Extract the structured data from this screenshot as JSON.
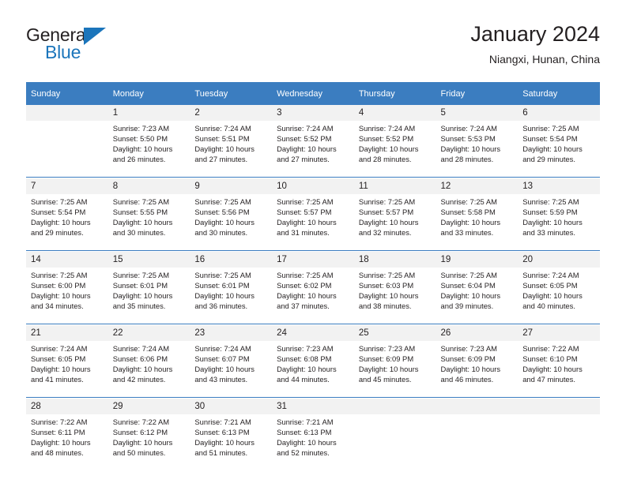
{
  "brand": {
    "name_top": "General",
    "name_bottom": "Blue",
    "accent_color": "#1b75bb"
  },
  "header": {
    "title": "January 2024",
    "subtitle": "Niangxi, Hunan, China"
  },
  "colors": {
    "header_row_bg": "#3b7dc0",
    "daynum_row_bg": "#f2f2f2",
    "separator": "#3b7dc0",
    "text": "#231f20"
  },
  "weekdays": [
    "Sunday",
    "Monday",
    "Tuesday",
    "Wednesday",
    "Thursday",
    "Friday",
    "Saturday"
  ],
  "weeks": [
    {
      "days": [
        {
          "num": "",
          "sunrise": "",
          "sunset": "",
          "daylight_1": "",
          "daylight_2": ""
        },
        {
          "num": "1",
          "sunrise": "Sunrise: 7:23 AM",
          "sunset": "Sunset: 5:50 PM",
          "daylight_1": "Daylight: 10 hours",
          "daylight_2": "and 26 minutes."
        },
        {
          "num": "2",
          "sunrise": "Sunrise: 7:24 AM",
          "sunset": "Sunset: 5:51 PM",
          "daylight_1": "Daylight: 10 hours",
          "daylight_2": "and 27 minutes."
        },
        {
          "num": "3",
          "sunrise": "Sunrise: 7:24 AM",
          "sunset": "Sunset: 5:52 PM",
          "daylight_1": "Daylight: 10 hours",
          "daylight_2": "and 27 minutes."
        },
        {
          "num": "4",
          "sunrise": "Sunrise: 7:24 AM",
          "sunset": "Sunset: 5:52 PM",
          "daylight_1": "Daylight: 10 hours",
          "daylight_2": "and 28 minutes."
        },
        {
          "num": "5",
          "sunrise": "Sunrise: 7:24 AM",
          "sunset": "Sunset: 5:53 PM",
          "daylight_1": "Daylight: 10 hours",
          "daylight_2": "and 28 minutes."
        },
        {
          "num": "6",
          "sunrise": "Sunrise: 7:25 AM",
          "sunset": "Sunset: 5:54 PM",
          "daylight_1": "Daylight: 10 hours",
          "daylight_2": "and 29 minutes."
        }
      ]
    },
    {
      "days": [
        {
          "num": "7",
          "sunrise": "Sunrise: 7:25 AM",
          "sunset": "Sunset: 5:54 PM",
          "daylight_1": "Daylight: 10 hours",
          "daylight_2": "and 29 minutes."
        },
        {
          "num": "8",
          "sunrise": "Sunrise: 7:25 AM",
          "sunset": "Sunset: 5:55 PM",
          "daylight_1": "Daylight: 10 hours",
          "daylight_2": "and 30 minutes."
        },
        {
          "num": "9",
          "sunrise": "Sunrise: 7:25 AM",
          "sunset": "Sunset: 5:56 PM",
          "daylight_1": "Daylight: 10 hours",
          "daylight_2": "and 30 minutes."
        },
        {
          "num": "10",
          "sunrise": "Sunrise: 7:25 AM",
          "sunset": "Sunset: 5:57 PM",
          "daylight_1": "Daylight: 10 hours",
          "daylight_2": "and 31 minutes."
        },
        {
          "num": "11",
          "sunrise": "Sunrise: 7:25 AM",
          "sunset": "Sunset: 5:57 PM",
          "daylight_1": "Daylight: 10 hours",
          "daylight_2": "and 32 minutes."
        },
        {
          "num": "12",
          "sunrise": "Sunrise: 7:25 AM",
          "sunset": "Sunset: 5:58 PM",
          "daylight_1": "Daylight: 10 hours",
          "daylight_2": "and 33 minutes."
        },
        {
          "num": "13",
          "sunrise": "Sunrise: 7:25 AM",
          "sunset": "Sunset: 5:59 PM",
          "daylight_1": "Daylight: 10 hours",
          "daylight_2": "and 33 minutes."
        }
      ]
    },
    {
      "days": [
        {
          "num": "14",
          "sunrise": "Sunrise: 7:25 AM",
          "sunset": "Sunset: 6:00 PM",
          "daylight_1": "Daylight: 10 hours",
          "daylight_2": "and 34 minutes."
        },
        {
          "num": "15",
          "sunrise": "Sunrise: 7:25 AM",
          "sunset": "Sunset: 6:01 PM",
          "daylight_1": "Daylight: 10 hours",
          "daylight_2": "and 35 minutes."
        },
        {
          "num": "16",
          "sunrise": "Sunrise: 7:25 AM",
          "sunset": "Sunset: 6:01 PM",
          "daylight_1": "Daylight: 10 hours",
          "daylight_2": "and 36 minutes."
        },
        {
          "num": "17",
          "sunrise": "Sunrise: 7:25 AM",
          "sunset": "Sunset: 6:02 PM",
          "daylight_1": "Daylight: 10 hours",
          "daylight_2": "and 37 minutes."
        },
        {
          "num": "18",
          "sunrise": "Sunrise: 7:25 AM",
          "sunset": "Sunset: 6:03 PM",
          "daylight_1": "Daylight: 10 hours",
          "daylight_2": "and 38 minutes."
        },
        {
          "num": "19",
          "sunrise": "Sunrise: 7:25 AM",
          "sunset": "Sunset: 6:04 PM",
          "daylight_1": "Daylight: 10 hours",
          "daylight_2": "and 39 minutes."
        },
        {
          "num": "20",
          "sunrise": "Sunrise: 7:24 AM",
          "sunset": "Sunset: 6:05 PM",
          "daylight_1": "Daylight: 10 hours",
          "daylight_2": "and 40 minutes."
        }
      ]
    },
    {
      "days": [
        {
          "num": "21",
          "sunrise": "Sunrise: 7:24 AM",
          "sunset": "Sunset: 6:05 PM",
          "daylight_1": "Daylight: 10 hours",
          "daylight_2": "and 41 minutes."
        },
        {
          "num": "22",
          "sunrise": "Sunrise: 7:24 AM",
          "sunset": "Sunset: 6:06 PM",
          "daylight_1": "Daylight: 10 hours",
          "daylight_2": "and 42 minutes."
        },
        {
          "num": "23",
          "sunrise": "Sunrise: 7:24 AM",
          "sunset": "Sunset: 6:07 PM",
          "daylight_1": "Daylight: 10 hours",
          "daylight_2": "and 43 minutes."
        },
        {
          "num": "24",
          "sunrise": "Sunrise: 7:23 AM",
          "sunset": "Sunset: 6:08 PM",
          "daylight_1": "Daylight: 10 hours",
          "daylight_2": "and 44 minutes."
        },
        {
          "num": "25",
          "sunrise": "Sunrise: 7:23 AM",
          "sunset": "Sunset: 6:09 PM",
          "daylight_1": "Daylight: 10 hours",
          "daylight_2": "and 45 minutes."
        },
        {
          "num": "26",
          "sunrise": "Sunrise: 7:23 AM",
          "sunset": "Sunset: 6:09 PM",
          "daylight_1": "Daylight: 10 hours",
          "daylight_2": "and 46 minutes."
        },
        {
          "num": "27",
          "sunrise": "Sunrise: 7:22 AM",
          "sunset": "Sunset: 6:10 PM",
          "daylight_1": "Daylight: 10 hours",
          "daylight_2": "and 47 minutes."
        }
      ]
    },
    {
      "days": [
        {
          "num": "28",
          "sunrise": "Sunrise: 7:22 AM",
          "sunset": "Sunset: 6:11 PM",
          "daylight_1": "Daylight: 10 hours",
          "daylight_2": "and 48 minutes."
        },
        {
          "num": "29",
          "sunrise": "Sunrise: 7:22 AM",
          "sunset": "Sunset: 6:12 PM",
          "daylight_1": "Daylight: 10 hours",
          "daylight_2": "and 50 minutes."
        },
        {
          "num": "30",
          "sunrise": "Sunrise: 7:21 AM",
          "sunset": "Sunset: 6:13 PM",
          "daylight_1": "Daylight: 10 hours",
          "daylight_2": "and 51 minutes."
        },
        {
          "num": "31",
          "sunrise": "Sunrise: 7:21 AM",
          "sunset": "Sunset: 6:13 PM",
          "daylight_1": "Daylight: 10 hours",
          "daylight_2": "and 52 minutes."
        },
        {
          "num": "",
          "sunrise": "",
          "sunset": "",
          "daylight_1": "",
          "daylight_2": ""
        },
        {
          "num": "",
          "sunrise": "",
          "sunset": "",
          "daylight_1": "",
          "daylight_2": ""
        },
        {
          "num": "",
          "sunrise": "",
          "sunset": "",
          "daylight_1": "",
          "daylight_2": ""
        }
      ]
    }
  ]
}
